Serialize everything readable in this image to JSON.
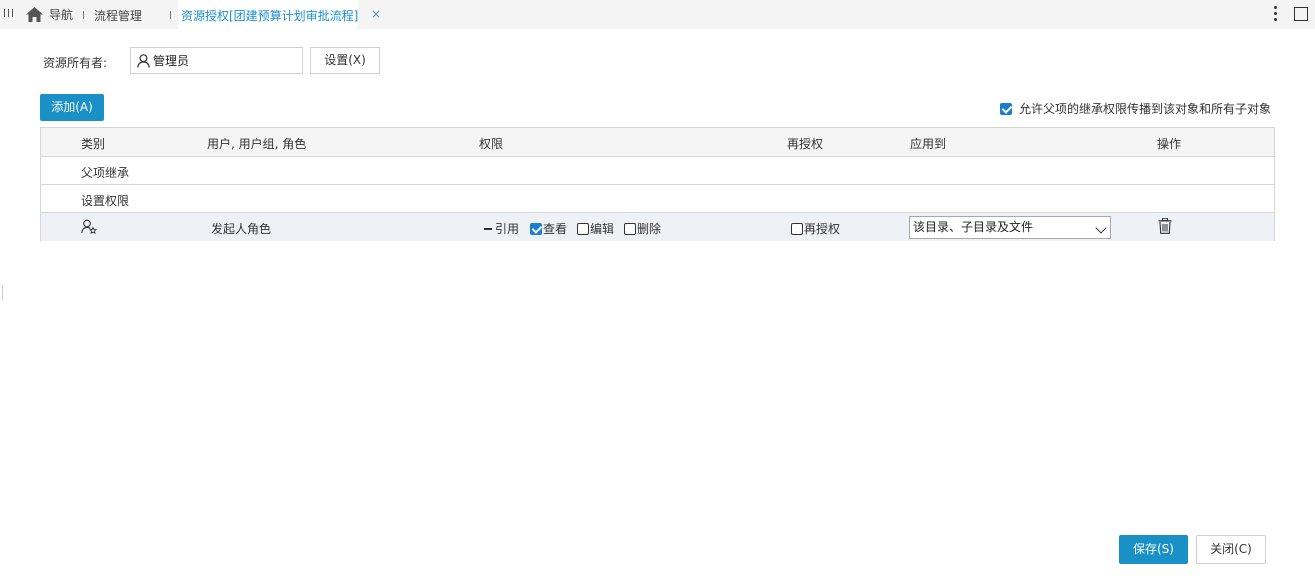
{
  "tabs": {
    "nav_label": "导航",
    "process_label": "流程管理",
    "active_label": "资源授权[团建预算计划审批流程]",
    "close_glyph": "×"
  },
  "owner": {
    "label": "资源所有者:",
    "value": "管理员",
    "set_button": "设置(X)"
  },
  "toolbar": {
    "add_button": "添加(A)",
    "allow_inherit_label": "允许父项的继承权限传播到该对象和所有子对象",
    "allow_inherit_checked": true
  },
  "table": {
    "headers": {
      "category": "类别",
      "users": "用户, 用户组, 角色",
      "permission": "权限",
      "regrant": "再授权",
      "apply_to": "应用到",
      "action": "操作"
    },
    "rows": [
      {
        "category": "父项继承"
      },
      {
        "category": "设置权限"
      },
      {
        "icon": "user-star-icon",
        "user": "发起人角色",
        "perms": {
          "reference": "引用",
          "view": "查看",
          "view_checked": true,
          "edit": "编辑",
          "edit_checked": false,
          "delete": "删除",
          "delete_checked": false
        },
        "regrant": "再授权",
        "regrant_checked": false,
        "apply_to": "该目录、子目录及文件"
      }
    ]
  },
  "footer": {
    "save_button": "保存(S)",
    "close_button": "关闭(C)"
  },
  "colors": {
    "primary": "#1991c6",
    "active_tab_text": "#1b8fd1"
  }
}
